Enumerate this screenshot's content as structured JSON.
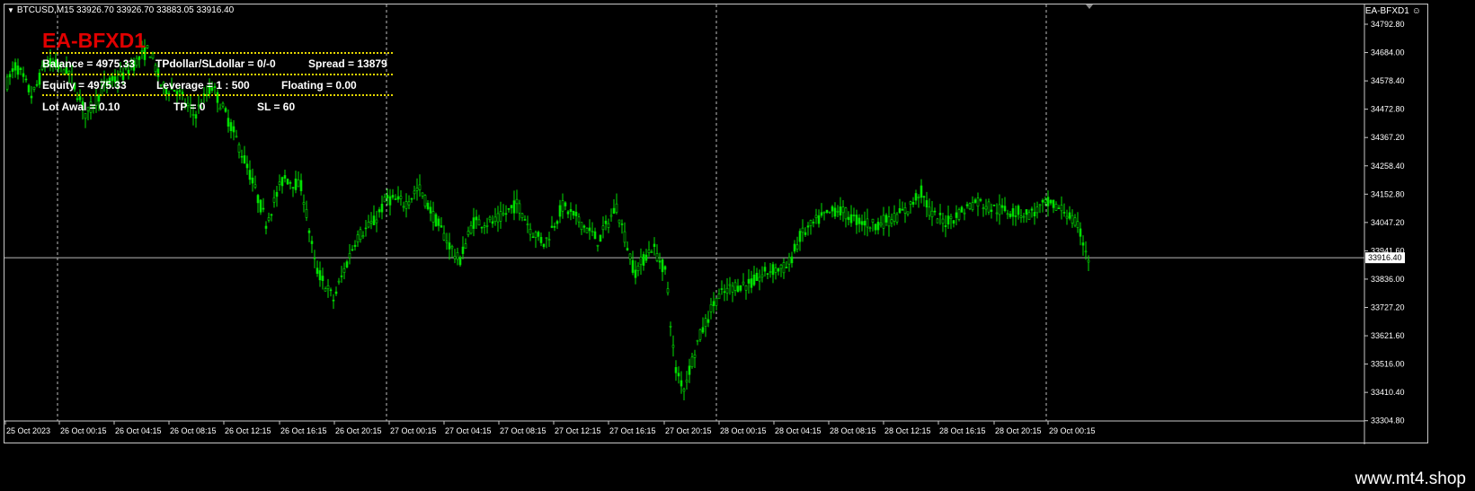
{
  "header": {
    "symbol_info": "BTCUSD,M15  33926.70 33926.70 33883.05 33916.40",
    "ea_name": "EA-BFXD1"
  },
  "panel": {
    "title": "EA-BFXD1",
    "row1": {
      "balance": "Balance = 4975.33",
      "tp_sl": "TPdollar/SLdollar = 0/-0",
      "spread": "Spread  = 13879"
    },
    "row2": {
      "equity": "Equity = 4975.33",
      "leverage": "Leverage = 1 : 500",
      "floating": "Floating = 0.00"
    },
    "row3": {
      "lot": "Lot Awal  = 0.10",
      "tp": "TP = 0",
      "sl": "SL = 60"
    }
  },
  "price_axis": {
    "labels": [
      "34792.80",
      "34684.00",
      "34578.40",
      "34472.80",
      "34367.20",
      "34258.40",
      "34152.80",
      "34047.20",
      "33941.60",
      "33836.00",
      "33727.20",
      "33621.60",
      "33516.00",
      "33410.40",
      "33304.80"
    ],
    "current_price": "33916.40"
  },
  "time_axis": {
    "labels": [
      "25 Oct 2023",
      "26 Oct 00:15",
      "26 Oct 04:15",
      "26 Oct 08:15",
      "26 Oct 12:15",
      "26 Oct 16:15",
      "26 Oct 20:15",
      "27 Oct 00:15",
      "27 Oct 04:15",
      "27 Oct 08:15",
      "27 Oct 12:15",
      "27 Oct 16:15",
      "27 Oct 20:15",
      "28 Oct 00:15",
      "28 Oct 04:15",
      "28 Oct 08:15",
      "28 Oct 12:15",
      "28 Oct 16:15",
      "28 Oct 20:15",
      "29 Oct 00:15"
    ]
  },
  "colors": {
    "candle": "#00e000",
    "background": "#000000",
    "axis": "#c8c8c8",
    "title": "#e00000",
    "dots": "#e8d800"
  },
  "footer": {
    "watermark": "www.mt4.shop"
  }
}
